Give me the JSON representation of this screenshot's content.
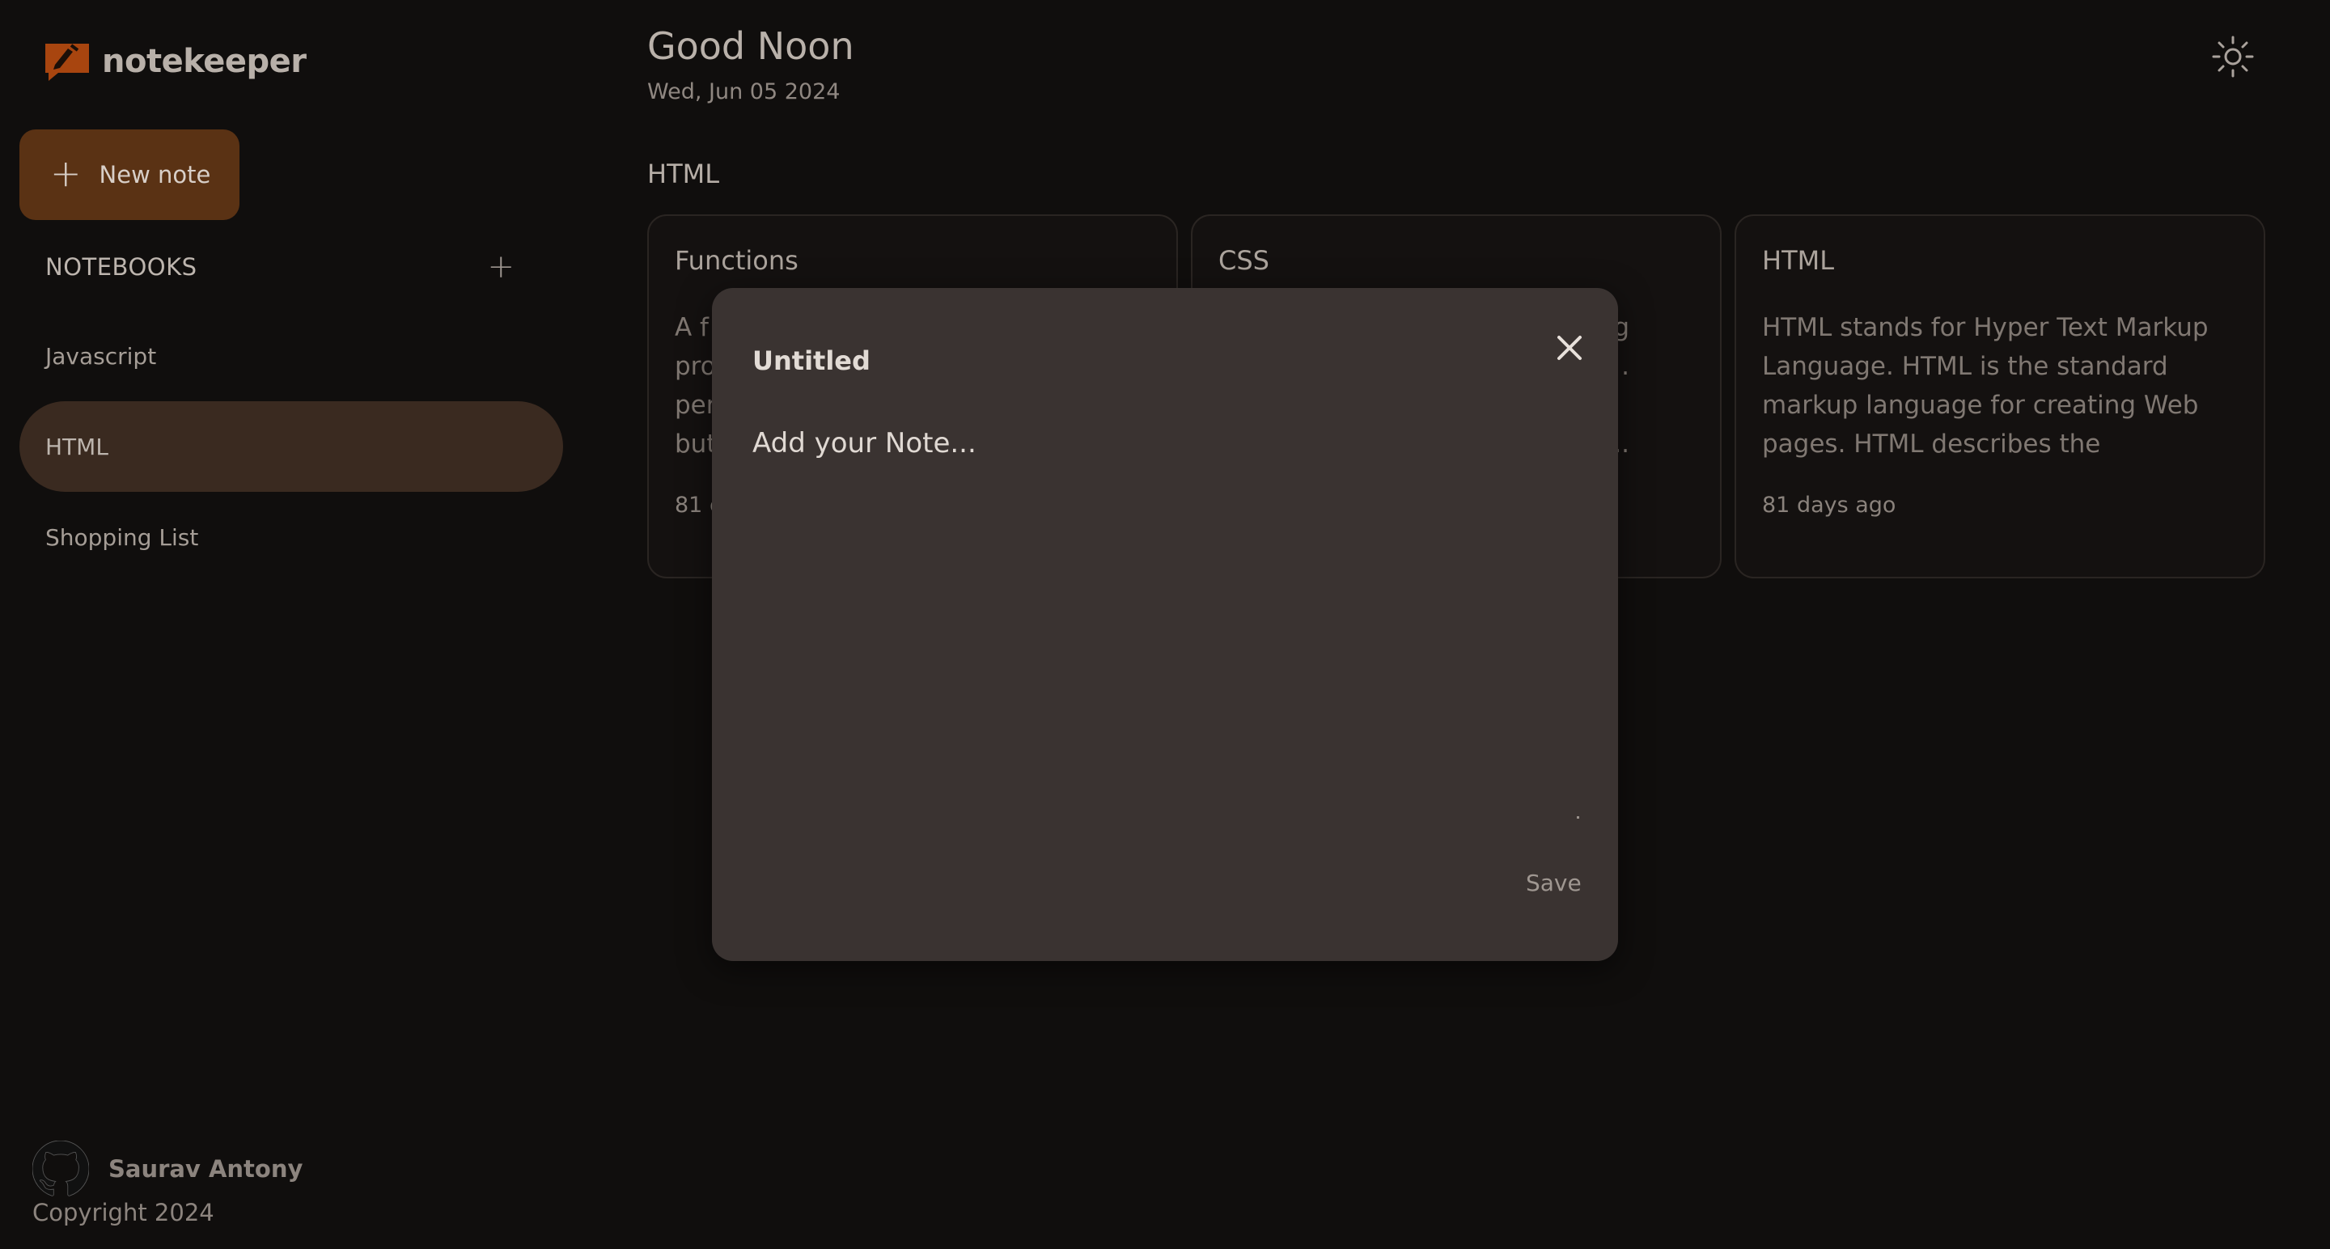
{
  "brand": {
    "name": "notekeeper",
    "logo_color": "#b54c11"
  },
  "sidebar": {
    "new_note_label": "New note",
    "notebooks_title": "NOTEBOOKS",
    "notebooks": [
      {
        "label": "Javascript",
        "active": false
      },
      {
        "label": "HTML",
        "active": true
      },
      {
        "label": "Shopping List",
        "active": false
      }
    ],
    "footer": {
      "author": "Saurav Antony",
      "copyright": "Copyright 2024"
    }
  },
  "header": {
    "greeting": "Good Noon",
    "date": "Wed, Jun 05 2024",
    "theme_icon": "sun-icon"
  },
  "main": {
    "section_title": "HTML",
    "cards": [
      {
        "title": "Functions",
        "body": "A f\npro\nper\nbut",
        "meta": "81 c"
      },
      {
        "title": "CSS",
        "body": "g\n.\n\n...",
        "meta": ""
      },
      {
        "title": "HTML",
        "body": "HTML stands for Hyper Text Markup Language. HTML is the standard markup language for creating Web pages. HTML describes the structure...",
        "meta": "81 days ago"
      }
    ]
  },
  "modal": {
    "title_placeholder": "Untitled",
    "text_placeholder": "Add your Note...",
    "save_label": "Save"
  },
  "colors": {
    "background": "#100e0d",
    "accent": "#5a3214",
    "active_item": "#3a2a20",
    "modal": "#3a3331"
  }
}
